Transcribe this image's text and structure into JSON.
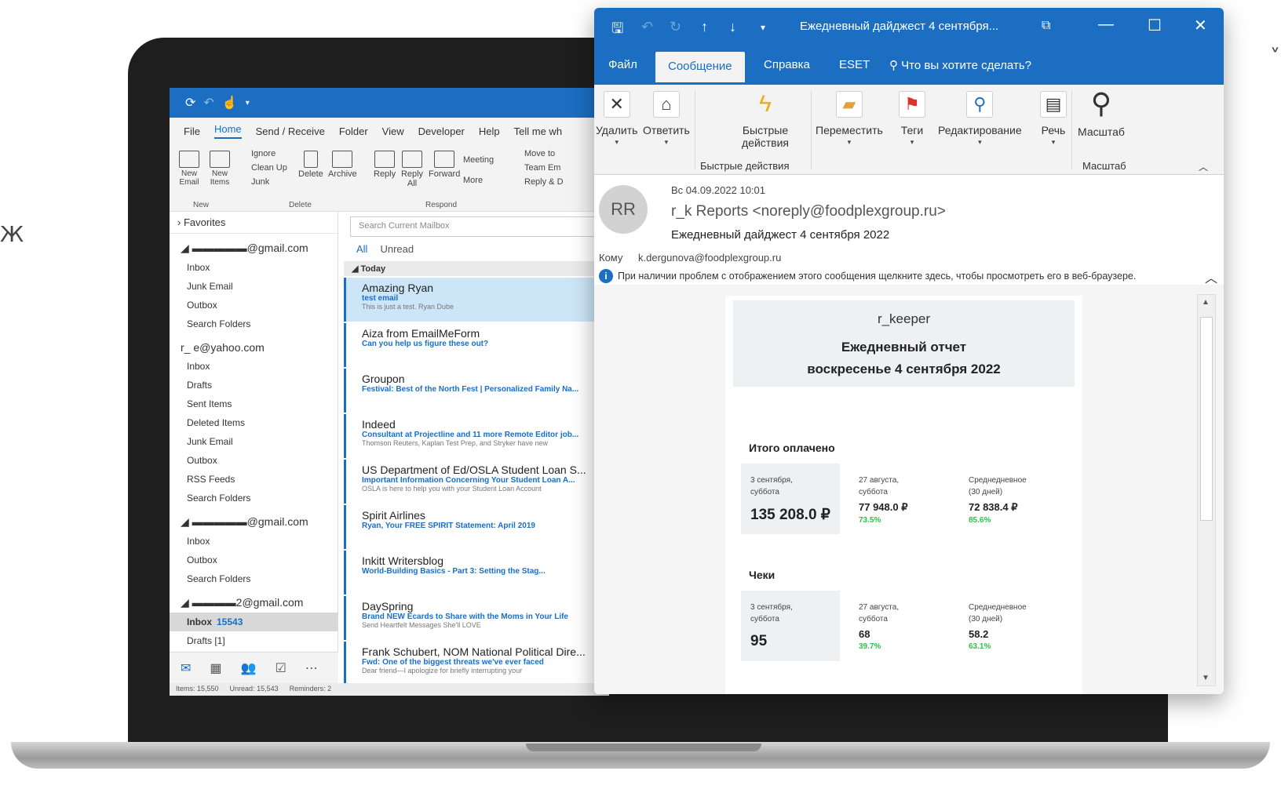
{
  "stray_text": "Ж",
  "stray_text_right": "˅",
  "background_app": {
    "menu": [
      "File",
      "Home",
      "Send / Receive",
      "Folder",
      "View",
      "Developer",
      "Help",
      "Tell me wh"
    ],
    "ribbon": {
      "new_email": "New Email",
      "new_items": "New Items",
      "ignore": "Ignore",
      "clean_up": "Clean Up",
      "junk": "Junk",
      "delete": "Delete",
      "archive": "Archive",
      "reply": "Reply",
      "reply_all": "Reply All",
      "forward": "Forward",
      "meeting": "Meeting",
      "more": "More",
      "move_to": "Move to",
      "team_email": "Team Em",
      "reply_del": "Reply & D",
      "group_new": "New",
      "group_delete": "Delete",
      "group_respond": "Respond"
    },
    "favorites": "Favorites",
    "accounts": [
      {
        "name": "@gmail.com",
        "folders": [
          "Inbox",
          "Junk Email",
          "Outbox",
          "Search Folders"
        ]
      },
      {
        "name": "r_    e@yahoo.com",
        "folders": [
          "Inbox",
          "Drafts",
          "Sent Items",
          "Deleted Items",
          "Junk Email",
          "Outbox",
          "RSS Feeds",
          "Search Folders"
        ]
      },
      {
        "name": "@gmail.com",
        "folders": [
          "Inbox",
          "Outbox",
          "Search Folders"
        ]
      },
      {
        "name": "2@gmail.com",
        "folders": [
          "Drafts [1]"
        ]
      }
    ],
    "inbox_selected": {
      "label": "Inbox",
      "count": "15543"
    },
    "search_placeholder": "Search Current Mailbox",
    "filters": [
      "All",
      "Unread"
    ],
    "today_label": "Today",
    "mails": [
      {
        "sender": "Amazing Ryan",
        "subject": "test email",
        "preview": "This is just a test.  Ryan Dube"
      },
      {
        "sender": "Aiza from EmailMeForm",
        "subject": "Can you help us figure these out?",
        "preview": ""
      },
      {
        "sender": "Groupon",
        "subject": "Festival: Best of the North Fest | Personalized Family Na...",
        "preview": ""
      },
      {
        "sender": "Indeed",
        "subject": "Consultant at Projectline and 11 more Remote Editor job...",
        "preview": "Thomson Reuters, Kaplan Test Prep, and Stryker have new"
      },
      {
        "sender": "US Department of Ed/OSLA Student Loan S...",
        "subject": "Important Information Concerning Your Student Loan A...",
        "preview": "OSLA is here to help you with your Student Loan Account"
      },
      {
        "sender": "Spirit Airlines",
        "subject": "Ryan, Your FREE SPIRIT Statement: April 2019",
        "preview": ""
      },
      {
        "sender": "Inkitt Writersblog",
        "subject": "World-Building Basics - Part 3: Setting the Stag...",
        "preview": ""
      },
      {
        "sender": "DaySpring",
        "subject": "Brand NEW Ecards to Share with the Moms in Your Life",
        "preview": "Send Heartfelt Messages She'll LOVE"
      },
      {
        "sender": "Frank Schubert, NOM National Political Dire...",
        "subject": "Fwd: One of the biggest threats we've ever faced",
        "preview": "Dear friend—I apologize for briefly interrupting your"
      }
    ],
    "status": {
      "items": "Items: 15,550",
      "unread": "Unread: 15,543",
      "reminders": "Reminders: 2"
    }
  },
  "message_window": {
    "title": "Ежедневный дайджест 4 сентября...",
    "tabs": [
      "Файл",
      "Сообщение",
      "Справка",
      "ESET"
    ],
    "tell_me": "Что вы хотите сделать?",
    "ribbon": {
      "delete": "Удалить",
      "reply": "Ответить",
      "quick_actions": "Быстрые действия",
      "quick_actions_group": "Быстрые действия",
      "move": "Переместить",
      "tags": "Теги",
      "edit": "Редактирование",
      "speech": "Речь",
      "zoom": "Масштаб",
      "zoom_group": "Масштаб"
    },
    "header": {
      "avatar": "RR",
      "date": "Вс 04.09.2022 10:01",
      "from": "r_k Reports <noreply@foodplexgroup.ru>",
      "subject": "Ежедневный дайджест 4 сентября 2022",
      "to_label": "Кому",
      "to_address": "k.dergunova@foodplexgroup.ru",
      "info": "При наличии проблем с отображением этого сообщения щелкните здесь, чтобы просмотреть его в веб-браузере."
    },
    "report": {
      "brand": "r_keeper",
      "title": "Ежедневный отчет",
      "date": "воскресенье 4 сентября 2022",
      "sections": [
        {
          "title": "Итого оплачено",
          "current_label": "3 сентября, суббота",
          "current_value": "135 208.0 ₽",
          "prev_label": "27 августа, суббота",
          "prev_value": "77 948.0 ₽",
          "prev_pct": "73.5%",
          "avg_label": "Среднедневное (30 дней)",
          "avg_value": "72 838.4 ₽",
          "avg_pct": "85.6%"
        },
        {
          "title": "Чеки",
          "current_label": "3 сентября, суббота",
          "current_value": "95",
          "prev_label": "27 августа, суббота",
          "prev_value": "68",
          "prev_pct": "39.7%",
          "avg_label": "Среднедневное (30 дней)",
          "avg_value": "58.2",
          "avg_pct": "63.1%"
        }
      ]
    }
  },
  "colors": {
    "accent": "#1b6ec2",
    "positive": "#2ec24a"
  }
}
